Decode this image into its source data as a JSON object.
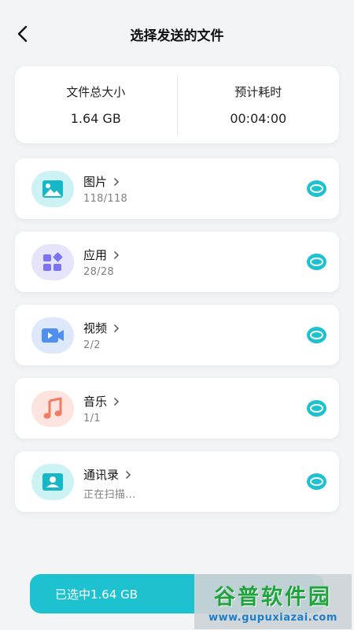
{
  "header": {
    "title": "选择发送的文件",
    "back_icon": "back-chevron-icon"
  },
  "summary": {
    "size_label": "文件总大小",
    "size_value": "1.64 GB",
    "time_label": "预计耗时",
    "time_value": "00:04:00"
  },
  "files": [
    {
      "name": "图片",
      "sub": "118/118",
      "icon": "image-icon",
      "icon_bg": "#ccf2f4",
      "icon_color": "#16b7c7",
      "selected": true
    },
    {
      "name": "应用",
      "sub": "28/28",
      "icon": "apps-icon",
      "icon_bg": "#e5e4fb",
      "icon_color": "#7c73f0",
      "selected": true
    },
    {
      "name": "视频",
      "sub": "2/2",
      "icon": "video-icon",
      "icon_bg": "#dde9fb",
      "icon_color": "#4f8fef",
      "selected": true
    },
    {
      "name": "音乐",
      "sub": "1/1",
      "icon": "music-icon",
      "icon_bg": "#fde4df",
      "icon_color": "#f27a62",
      "selected": true
    },
    {
      "name": "通讯录",
      "sub": "正在扫描...",
      "icon": "contact-icon",
      "icon_bg": "#ccf2f4",
      "icon_color": "#16b7c7",
      "selected": true
    }
  ],
  "bottom": {
    "selected_label": "已选中1.64 GB"
  },
  "watermark": {
    "title": "谷普软件园",
    "url": "www.gupuxiazai.com"
  },
  "colors": {
    "accent": "#1ec1cf",
    "background": "#f3f4f6",
    "card": "#ffffff"
  }
}
